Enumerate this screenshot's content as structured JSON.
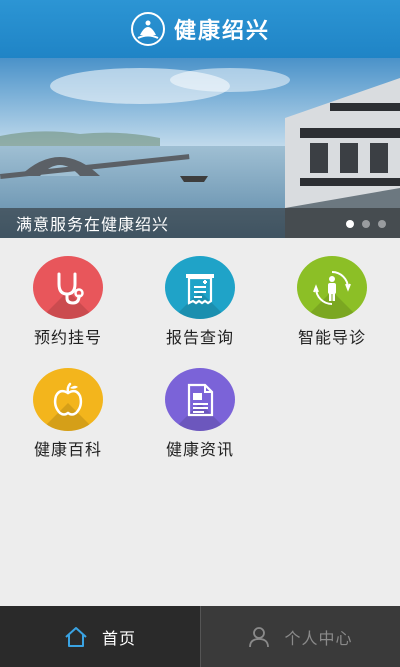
{
  "header": {
    "title": "健康绍兴",
    "logo_icon": "shaoxing-emblem-logo"
  },
  "banner": {
    "caption": "满意服务在健康绍兴",
    "slides": 3,
    "active_slide": 0
  },
  "tiles": [
    {
      "label": "预约挂号",
      "icon": "stethoscope-icon",
      "color": "#e8565b"
    },
    {
      "label": "报告查询",
      "icon": "report-document-icon",
      "color": "#1fa3c8"
    },
    {
      "label": "智能导诊",
      "icon": "person-guide-icon",
      "color": "#8cbf26"
    },
    {
      "label": "健康百科",
      "icon": "apple-icon",
      "color": "#f3b51c"
    },
    {
      "label": "健康资讯",
      "icon": "news-document-icon",
      "color": "#7b63d8"
    }
  ],
  "bottom_nav": {
    "home_label": "首页",
    "profile_label": "个人中心",
    "active_color": "#3aa3e3"
  }
}
